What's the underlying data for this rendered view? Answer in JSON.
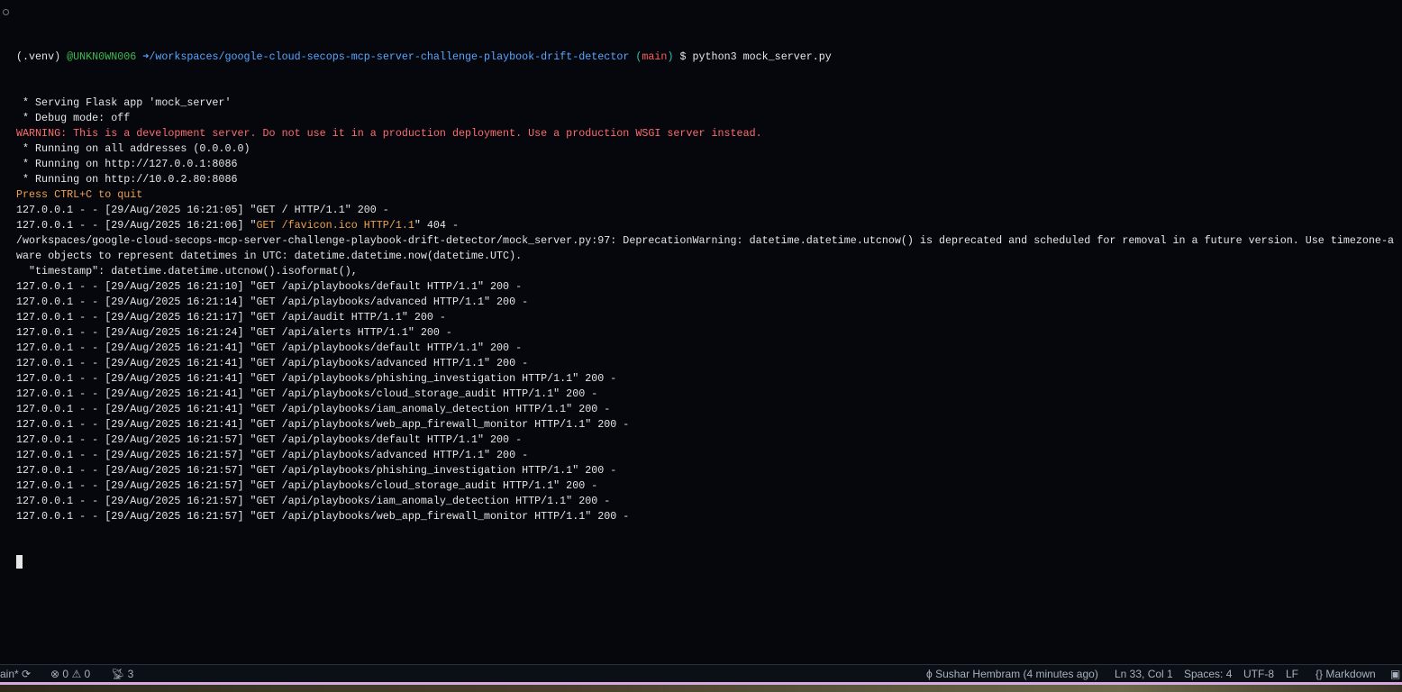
{
  "prompt": {
    "venv": "(.venv) ",
    "user": "@UNKN0WN006 ",
    "arrow_path": "➜/workspaces/google-cloud-secops-mcp-server-challenge-playbook-drift-detector ",
    "paren_open": "(",
    "branch": "main",
    "paren_close": ")",
    "command": " $ python3 mock_server.py"
  },
  "output_lines": [
    {
      "text": " * Serving Flask app 'mock_server'",
      "style": ""
    },
    {
      "text": " * Debug mode: off",
      "style": ""
    },
    {
      "text": "WARNING: This is a development server. Do not use it in a production deployment. Use a production WSGI server instead.",
      "style": "c-warn"
    },
    {
      "text": " * Running on all addresses (0.0.0.0)",
      "style": ""
    },
    {
      "text": " * Running on http://127.0.0.1:8086",
      "style": ""
    },
    {
      "text": " * Running on http://10.0.2.80:8086",
      "style": ""
    },
    {
      "text": "Press CTRL+C to quit",
      "style": "c-orange"
    },
    {
      "text": "127.0.0.1 - - [29/Aug/2025 16:21:05] \"GET / HTTP/1.1\" 200 -",
      "style": ""
    },
    {
      "text": "127.0.0.1 - - [29/Aug/2025 16:21:06] \"",
      "highlight": "GET /favicon.ico HTTP/1.1",
      "suffix": "\" 404 -",
      "style": ""
    },
    {
      "text": "/workspaces/google-cloud-secops-mcp-server-challenge-playbook-drift-detector/mock_server.py:97: DeprecationWarning: datetime.datetime.utcnow() is deprecated and scheduled for removal in a future version. Use timezone-a",
      "style": ""
    },
    {
      "text": "ware objects to represent datetimes in UTC: datetime.datetime.now(datetime.UTC).",
      "style": ""
    },
    {
      "text": "  \"timestamp\": datetime.datetime.utcnow().isoformat(),",
      "style": ""
    },
    {
      "text": "127.0.0.1 - - [29/Aug/2025 16:21:10] \"GET /api/playbooks/default HTTP/1.1\" 200 -",
      "style": ""
    },
    {
      "text": "127.0.0.1 - - [29/Aug/2025 16:21:14] \"GET /api/playbooks/advanced HTTP/1.1\" 200 -",
      "style": ""
    },
    {
      "text": "127.0.0.1 - - [29/Aug/2025 16:21:17] \"GET /api/audit HTTP/1.1\" 200 -",
      "style": ""
    },
    {
      "text": "127.0.0.1 - - [29/Aug/2025 16:21:24] \"GET /api/alerts HTTP/1.1\" 200 -",
      "style": ""
    },
    {
      "text": "127.0.0.1 - - [29/Aug/2025 16:21:41] \"GET /api/playbooks/default HTTP/1.1\" 200 -",
      "style": ""
    },
    {
      "text": "127.0.0.1 - - [29/Aug/2025 16:21:41] \"GET /api/playbooks/advanced HTTP/1.1\" 200 -",
      "style": ""
    },
    {
      "text": "127.0.0.1 - - [29/Aug/2025 16:21:41] \"GET /api/playbooks/phishing_investigation HTTP/1.1\" 200 -",
      "style": ""
    },
    {
      "text": "127.0.0.1 - - [29/Aug/2025 16:21:41] \"GET /api/playbooks/cloud_storage_audit HTTP/1.1\" 200 -",
      "style": ""
    },
    {
      "text": "127.0.0.1 - - [29/Aug/2025 16:21:41] \"GET /api/playbooks/iam_anomaly_detection HTTP/1.1\" 200 -",
      "style": ""
    },
    {
      "text": "127.0.0.1 - - [29/Aug/2025 16:21:41] \"GET /api/playbooks/web_app_firewall_monitor HTTP/1.1\" 200 -",
      "style": ""
    },
    {
      "text": "127.0.0.1 - - [29/Aug/2025 16:21:57] \"GET /api/playbooks/default HTTP/1.1\" 200 -",
      "style": ""
    },
    {
      "text": "127.0.0.1 - - [29/Aug/2025 16:21:57] \"GET /api/playbooks/advanced HTTP/1.1\" 200 -",
      "style": ""
    },
    {
      "text": "127.0.0.1 - - [29/Aug/2025 16:21:57] \"GET /api/playbooks/phishing_investigation HTTP/1.1\" 200 -",
      "style": ""
    },
    {
      "text": "127.0.0.1 - - [29/Aug/2025 16:21:57] \"GET /api/playbooks/cloud_storage_audit HTTP/1.1\" 200 -",
      "style": ""
    },
    {
      "text": "127.0.0.1 - - [29/Aug/2025 16:21:57] \"GET /api/playbooks/iam_anomaly_detection HTTP/1.1\" 200 -",
      "style": ""
    },
    {
      "text": "127.0.0.1 - - [29/Aug/2025 16:21:57] \"GET /api/playbooks/web_app_firewall_monitor HTTP/1.1\" 200 -",
      "style": ""
    }
  ],
  "status_bar": {
    "branch": "ain*",
    "errors": "0",
    "warnings": "0",
    "ports": "3",
    "blame": "Sushar Hembram (4 minutes ago)",
    "position": "Ln 33, Col 1",
    "spaces": "Spaces: 4",
    "encoding": "UTF-8",
    "eol": "LF",
    "language": "Markdown"
  }
}
